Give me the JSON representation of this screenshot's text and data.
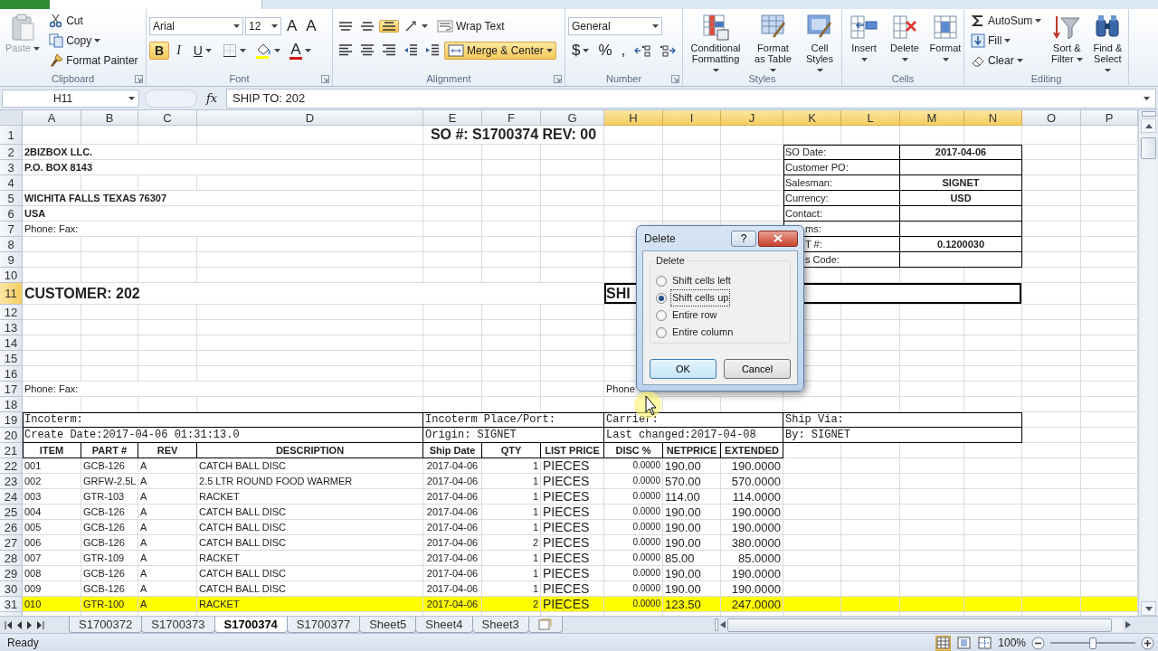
{
  "ribbon": {
    "groups": [
      {
        "label": "Clipboard",
        "launcher": true,
        "items": [
          {
            "kind": "large",
            "label": "Paste",
            "disabled": true,
            "dropdown": true
          },
          {
            "kind": "stack",
            "lines": [
              {
                "controls": [
                  {
                    "kind": "button",
                    "label": "Cut"
                  }
                ]
              },
              {
                "controls": [
                  {
                    "kind": "button",
                    "label": "Copy",
                    "dropdown": true
                  }
                ]
              },
              {
                "controls": [
                  {
                    "kind": "button",
                    "label": "Format Painter"
                  }
                ]
              }
            ]
          }
        ]
      },
      {
        "label": "Font",
        "launcher": true,
        "items": [
          {
            "kind": "stack",
            "lines": [
              {
                "controls": [
                  {
                    "kind": "combo",
                    "value": "Arial"
                  },
                  {
                    "kind": "combo",
                    "value": "12"
                  },
                  {
                    "kind": "glyph",
                    "label": "A"
                  },
                  {
                    "kind": "glyph",
                    "label": "A"
                  }
                ]
              },
              {
                "controls": [
                  {
                    "kind": "letter-toggle",
                    "label": "B",
                    "selected": true
                  },
                  {
                    "kind": "letter-toggle",
                    "label": "I",
                    "selected": false
                  },
                  {
                    "kind": "letter-toggle",
                    "label": "U",
                    "selected": false,
                    "dropdown": true
                  },
                  {
                    "kind": "icon",
                    "dropdown": true
                  },
                  {
                    "kind": "icon",
                    "dropdown": true
                  },
                  {
                    "kind": "glyph",
                    "label": "A",
                    "color": "#d01010",
                    "dropdown": true
                  }
                ]
              }
            ]
          }
        ]
      },
      {
        "label": "Alignment",
        "launcher": true,
        "items": [
          {
            "kind": "stack",
            "lines": [
              {
                "controls": [
                  {
                    "kind": "toggle",
                    "selected": false
                  },
                  {
                    "kind": "toggle",
                    "selected": false
                  },
                  {
                    "kind": "toggle",
                    "selected": true
                  },
                  {
                    "kind": "icon",
                    "dropdown": true
                  },
                  {
                    "kind": "button",
                    "label": "Wrap Text"
                  }
                ]
              },
              {
                "controls": [
                  {
                    "kind": "toggle",
                    "selected": false
                  },
                  {
                    "kind": "toggle",
                    "selected": false
                  },
                  {
                    "kind": "toggle",
                    "selected": false
                  },
                  {
                    "kind": "icon"
                  },
                  {
                    "kind": "icon"
                  },
                  {
                    "kind": "toggle",
                    "label": "Merge & Center",
                    "selected": true,
                    "dropdown": true
                  }
                ]
              }
            ]
          }
        ]
      },
      {
        "label": "Number",
        "launcher": true,
        "items": [
          {
            "kind": "stack",
            "lines": [
              {
                "controls": [
                  {
                    "kind": "combo",
                    "value": "General"
                  }
                ]
              },
              {
                "controls": [
                  {
                    "kind": "glyph",
                    "label": "$",
                    "dropdown": true
                  },
                  {
                    "kind": "glyph",
                    "label": "%"
                  },
                  {
                    "kind": "glyph",
                    "label": ","
                  },
                  {
                    "kind": "icon"
                  },
                  {
                    "kind": "icon"
                  }
                ]
              }
            ]
          }
        ]
      },
      {
        "label": "Styles",
        "items": [
          {
            "kind": "large",
            "label": "Conditional Formatting",
            "dropdown": true
          },
          {
            "kind": "large",
            "label": "Format as Table",
            "dropdown": true
          },
          {
            "kind": "large",
            "label": "Cell Styles",
            "dropdown": true
          }
        ]
      },
      {
        "label": "Cells",
        "items": [
          {
            "kind": "large",
            "label": "Insert",
            "dropdown": true
          },
          {
            "kind": "large",
            "label": "Delete",
            "dropdown": true
          },
          {
            "kind": "large",
            "label": "Format",
            "dropdown": true
          }
        ]
      },
      {
        "label": "Editing",
        "items": [
          {
            "kind": "stack",
            "lines": [
              {
                "controls": [
                  {
                    "kind": "button",
                    "label": "AutoSum",
                    "dropdown": true
                  }
                ]
              },
              {
                "controls": [
                  {
                    "kind": "button",
                    "label": "Fill",
                    "dropdown": true
                  }
                ]
              },
              {
                "controls": [
                  {
                    "kind": "button",
                    "label": "Clear",
                    "dropdown": true
                  }
                ]
              }
            ]
          },
          {
            "kind": "large",
            "label": "Sort & Filter",
            "dropdown": true
          },
          {
            "kind": "large",
            "label": "Find & Select",
            "dropdown": true
          }
        ]
      }
    ]
  },
  "formula_bar": {
    "name_box": "H11",
    "fx": "fx",
    "content": "SHIP TO:  202"
  },
  "sheet": {
    "columns": [
      {
        "letter": "A",
        "selected": false
      },
      {
        "letter": "B",
        "selected": false
      },
      {
        "letter": "C",
        "selected": false
      },
      {
        "letter": "D",
        "selected": false
      },
      {
        "letter": "E",
        "selected": false
      },
      {
        "letter": "F",
        "selected": false
      },
      {
        "letter": "G",
        "selected": false
      },
      {
        "letter": "H",
        "selected": true
      },
      {
        "letter": "I",
        "selected": true
      },
      {
        "letter": "J",
        "selected": true
      },
      {
        "letter": "K",
        "selected": true
      },
      {
        "letter": "L",
        "selected": true
      },
      {
        "letter": "M",
        "selected": true
      },
      {
        "letter": "N",
        "selected": true
      },
      {
        "letter": "O",
        "selected": false
      },
      {
        "letter": "P",
        "selected": false
      }
    ],
    "row_headers": [
      {
        "number": "1",
        "selected": false
      },
      {
        "number": "2",
        "selected": false
      },
      {
        "number": "3",
        "selected": false
      },
      {
        "number": "4",
        "selected": false
      },
      {
        "number": "5",
        "selected": false
      },
      {
        "number": "6",
        "selected": false
      },
      {
        "number": "7",
        "selected": false
      },
      {
        "number": "8",
        "selected": false
      },
      {
        "number": "9",
        "selected": false
      },
      {
        "number": "10",
        "selected": false
      },
      {
        "number": "11",
        "selected": true
      },
      {
        "number": "12",
        "selected": false
      },
      {
        "number": "13",
        "selected": false
      },
      {
        "number": "14",
        "selected": false
      },
      {
        "number": "15",
        "selected": false
      },
      {
        "number": "16",
        "selected": false
      },
      {
        "number": "17",
        "selected": false
      },
      {
        "number": "18",
        "selected": false
      },
      {
        "number": "19",
        "selected": false
      },
      {
        "number": "20",
        "selected": false
      },
      {
        "number": "21",
        "selected": false
      },
      {
        "number": "22",
        "selected": false
      },
      {
        "number": "23",
        "selected": false
      },
      {
        "number": "24",
        "selected": false
      },
      {
        "number": "25",
        "selected": false
      },
      {
        "number": "26",
        "selected": false
      },
      {
        "number": "27",
        "selected": false
      },
      {
        "number": "28",
        "selected": false
      },
      {
        "number": "29",
        "selected": false
      },
      {
        "number": "30",
        "selected": false
      },
      {
        "number": "31",
        "selected": false
      }
    ],
    "title": "SO #: S1700374  REV: 00",
    "address": [
      "2BIZBOX LLC.",
      "P.O. BOX 8143",
      "WICHITA FALLS  TEXAS  76307",
      "USA",
      "Phone:  Fax:"
    ],
    "info": [
      {
        "label": "SO Date:",
        "value": "2017-04-06"
      },
      {
        "label": "Customer PO:"
      },
      {
        "label": "Salesman:",
        "value": "SIGNET"
      },
      {
        "label": "Currency:",
        "value": "USD"
      },
      {
        "label": "Contact:"
      },
      {
        "label": "ms:"
      },
      {
        "label": "T #:",
        "value": "0.1200030"
      },
      {
        "label": "s Code:"
      }
    ],
    "customer": "CUSTOMER:  202",
    "ship_to": {
      "text": "SHI",
      "selected": true
    },
    "contact_line": "Phone:  Fax:",
    "ship_contact": "Phone",
    "terms": [
      [
        "Incoterm:",
        "Incoterm Place/Port:",
        "Carrier:",
        "Ship Via:"
      ],
      [
        "Create Date:2017-04-06 01:31:13.0",
        "Origin:  SIGNET",
        "Last changed:2017-04-08",
        "By:  SIGNET"
      ]
    ],
    "item_columns": [
      "ITEM",
      "PART #",
      "REV",
      "DESCRIPTION",
      "Ship Date",
      "QTY",
      "LIST PRICE",
      "DISC %",
      "NETPRICE",
      "EXTENDED"
    ],
    "items": [
      {
        "highlighted": false,
        "cells": [
          "001",
          "GCB-126",
          "A",
          "CATCH BALL DISC",
          "2017-04-06",
          "1",
          "PIECES",
          "0.0000",
          "190.00",
          "190.0000"
        ]
      },
      {
        "highlighted": false,
        "cells": [
          "002",
          "GRFW-2.5L",
          "A",
          "2.5 LTR ROUND FOOD WARMER",
          "2017-04-06",
          "1",
          "PIECES",
          "0.0000",
          "570.00",
          "570.0000"
        ]
      },
      {
        "highlighted": false,
        "cells": [
          "003",
          "GTR-103",
          "A",
          "RACKET",
          "2017-04-06",
          "1",
          "PIECES",
          "0.0000",
          "114.00",
          "114.0000"
        ]
      },
      {
        "highlighted": false,
        "cells": [
          "004",
          "GCB-126",
          "A",
          "CATCH BALL DISC",
          "2017-04-06",
          "1",
          "PIECES",
          "0.0000",
          "190.00",
          "190.0000"
        ]
      },
      {
        "highlighted": false,
        "cells": [
          "005",
          "GCB-126",
          "A",
          "CATCH BALL DISC",
          "2017-04-06",
          "1",
          "PIECES",
          "0.0000",
          "190.00",
          "190.0000"
        ]
      },
      {
        "highlighted": false,
        "cells": [
          "006",
          "GCB-126",
          "A",
          "CATCH BALL DISC",
          "2017-04-06",
          "2",
          "PIECES",
          "0.0000",
          "190.00",
          "380.0000"
        ]
      },
      {
        "highlighted": false,
        "cells": [
          "007",
          "GTR-109",
          "A",
          "RACKET",
          "2017-04-06",
          "1",
          "PIECES",
          "0.0000",
          "85.00",
          "85.0000"
        ]
      },
      {
        "highlighted": false,
        "cells": [
          "008",
          "GCB-126",
          "A",
          "CATCH BALL DISC",
          "2017-04-06",
          "1",
          "PIECES",
          "0.0000",
          "190.00",
          "190.0000"
        ]
      },
      {
        "highlighted": false,
        "cells": [
          "009",
          "GCB-126",
          "A",
          "CATCH BALL DISC",
          "2017-04-06",
          "1",
          "PIECES",
          "0.0000",
          "190.00",
          "190.0000"
        ]
      },
      {
        "highlighted": true,
        "cells": [
          "010",
          "GTR-100",
          "A",
          "RACKET",
          "2017-04-06",
          "2",
          "PIECES",
          "0.0000",
          "123.50",
          "247.0000"
        ]
      }
    ]
  },
  "dialog": {
    "title": "Delete",
    "help": "?",
    "group_label": "Delete",
    "options": [
      {
        "label": "Shift cells left",
        "selected": false
      },
      {
        "label": "Shift cells up",
        "selected": true
      },
      {
        "label": "Entire row",
        "selected": false
      },
      {
        "label": "Entire column",
        "selected": false
      }
    ],
    "buttons": [
      {
        "label": "OK",
        "focused": true
      },
      {
        "label": "Cancel",
        "focused": false
      }
    ]
  },
  "sheet_tabs": [
    {
      "label": "S1700372",
      "selected": false
    },
    {
      "label": "S1700373",
      "selected": false
    },
    {
      "label": "S1700374",
      "selected": true
    },
    {
      "label": "S1700377",
      "selected": false
    },
    {
      "label": "Sheet5",
      "selected": false
    },
    {
      "label": "Sheet4",
      "selected": false
    },
    {
      "label": "Sheet3",
      "selected": false
    }
  ],
  "status_bar": {
    "text": "Ready",
    "views": [
      {
        "selected": true
      },
      {
        "selected": false
      },
      {
        "selected": false
      }
    ],
    "zoom": {
      "label": "100%",
      "level": 0.5
    }
  }
}
